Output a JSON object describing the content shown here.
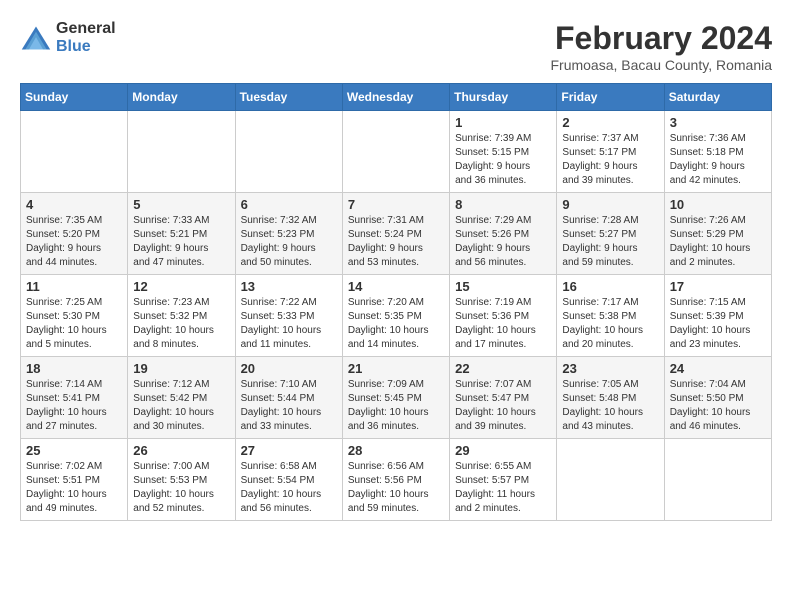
{
  "logo": {
    "general": "General",
    "blue": "Blue"
  },
  "title": "February 2024",
  "location": "Frumoasa, Bacau County, Romania",
  "days_of_week": [
    "Sunday",
    "Monday",
    "Tuesday",
    "Wednesday",
    "Thursday",
    "Friday",
    "Saturday"
  ],
  "weeks": [
    [
      {
        "num": "",
        "info": ""
      },
      {
        "num": "",
        "info": ""
      },
      {
        "num": "",
        "info": ""
      },
      {
        "num": "",
        "info": ""
      },
      {
        "num": "1",
        "info": "Sunrise: 7:39 AM\nSunset: 5:15 PM\nDaylight: 9 hours\nand 36 minutes."
      },
      {
        "num": "2",
        "info": "Sunrise: 7:37 AM\nSunset: 5:17 PM\nDaylight: 9 hours\nand 39 minutes."
      },
      {
        "num": "3",
        "info": "Sunrise: 7:36 AM\nSunset: 5:18 PM\nDaylight: 9 hours\nand 42 minutes."
      }
    ],
    [
      {
        "num": "4",
        "info": "Sunrise: 7:35 AM\nSunset: 5:20 PM\nDaylight: 9 hours\nand 44 minutes."
      },
      {
        "num": "5",
        "info": "Sunrise: 7:33 AM\nSunset: 5:21 PM\nDaylight: 9 hours\nand 47 minutes."
      },
      {
        "num": "6",
        "info": "Sunrise: 7:32 AM\nSunset: 5:23 PM\nDaylight: 9 hours\nand 50 minutes."
      },
      {
        "num": "7",
        "info": "Sunrise: 7:31 AM\nSunset: 5:24 PM\nDaylight: 9 hours\nand 53 minutes."
      },
      {
        "num": "8",
        "info": "Sunrise: 7:29 AM\nSunset: 5:26 PM\nDaylight: 9 hours\nand 56 minutes."
      },
      {
        "num": "9",
        "info": "Sunrise: 7:28 AM\nSunset: 5:27 PM\nDaylight: 9 hours\nand 59 minutes."
      },
      {
        "num": "10",
        "info": "Sunrise: 7:26 AM\nSunset: 5:29 PM\nDaylight: 10 hours\nand 2 minutes."
      }
    ],
    [
      {
        "num": "11",
        "info": "Sunrise: 7:25 AM\nSunset: 5:30 PM\nDaylight: 10 hours\nand 5 minutes."
      },
      {
        "num": "12",
        "info": "Sunrise: 7:23 AM\nSunset: 5:32 PM\nDaylight: 10 hours\nand 8 minutes."
      },
      {
        "num": "13",
        "info": "Sunrise: 7:22 AM\nSunset: 5:33 PM\nDaylight: 10 hours\nand 11 minutes."
      },
      {
        "num": "14",
        "info": "Sunrise: 7:20 AM\nSunset: 5:35 PM\nDaylight: 10 hours\nand 14 minutes."
      },
      {
        "num": "15",
        "info": "Sunrise: 7:19 AM\nSunset: 5:36 PM\nDaylight: 10 hours\nand 17 minutes."
      },
      {
        "num": "16",
        "info": "Sunrise: 7:17 AM\nSunset: 5:38 PM\nDaylight: 10 hours\nand 20 minutes."
      },
      {
        "num": "17",
        "info": "Sunrise: 7:15 AM\nSunset: 5:39 PM\nDaylight: 10 hours\nand 23 minutes."
      }
    ],
    [
      {
        "num": "18",
        "info": "Sunrise: 7:14 AM\nSunset: 5:41 PM\nDaylight: 10 hours\nand 27 minutes."
      },
      {
        "num": "19",
        "info": "Sunrise: 7:12 AM\nSunset: 5:42 PM\nDaylight: 10 hours\nand 30 minutes."
      },
      {
        "num": "20",
        "info": "Sunrise: 7:10 AM\nSunset: 5:44 PM\nDaylight: 10 hours\nand 33 minutes."
      },
      {
        "num": "21",
        "info": "Sunrise: 7:09 AM\nSunset: 5:45 PM\nDaylight: 10 hours\nand 36 minutes."
      },
      {
        "num": "22",
        "info": "Sunrise: 7:07 AM\nSunset: 5:47 PM\nDaylight: 10 hours\nand 39 minutes."
      },
      {
        "num": "23",
        "info": "Sunrise: 7:05 AM\nSunset: 5:48 PM\nDaylight: 10 hours\nand 43 minutes."
      },
      {
        "num": "24",
        "info": "Sunrise: 7:04 AM\nSunset: 5:50 PM\nDaylight: 10 hours\nand 46 minutes."
      }
    ],
    [
      {
        "num": "25",
        "info": "Sunrise: 7:02 AM\nSunset: 5:51 PM\nDaylight: 10 hours\nand 49 minutes."
      },
      {
        "num": "26",
        "info": "Sunrise: 7:00 AM\nSunset: 5:53 PM\nDaylight: 10 hours\nand 52 minutes."
      },
      {
        "num": "27",
        "info": "Sunrise: 6:58 AM\nSunset: 5:54 PM\nDaylight: 10 hours\nand 56 minutes."
      },
      {
        "num": "28",
        "info": "Sunrise: 6:56 AM\nSunset: 5:56 PM\nDaylight: 10 hours\nand 59 minutes."
      },
      {
        "num": "29",
        "info": "Sunrise: 6:55 AM\nSunset: 5:57 PM\nDaylight: 11 hours\nand 2 minutes."
      },
      {
        "num": "",
        "info": ""
      },
      {
        "num": "",
        "info": ""
      }
    ]
  ]
}
